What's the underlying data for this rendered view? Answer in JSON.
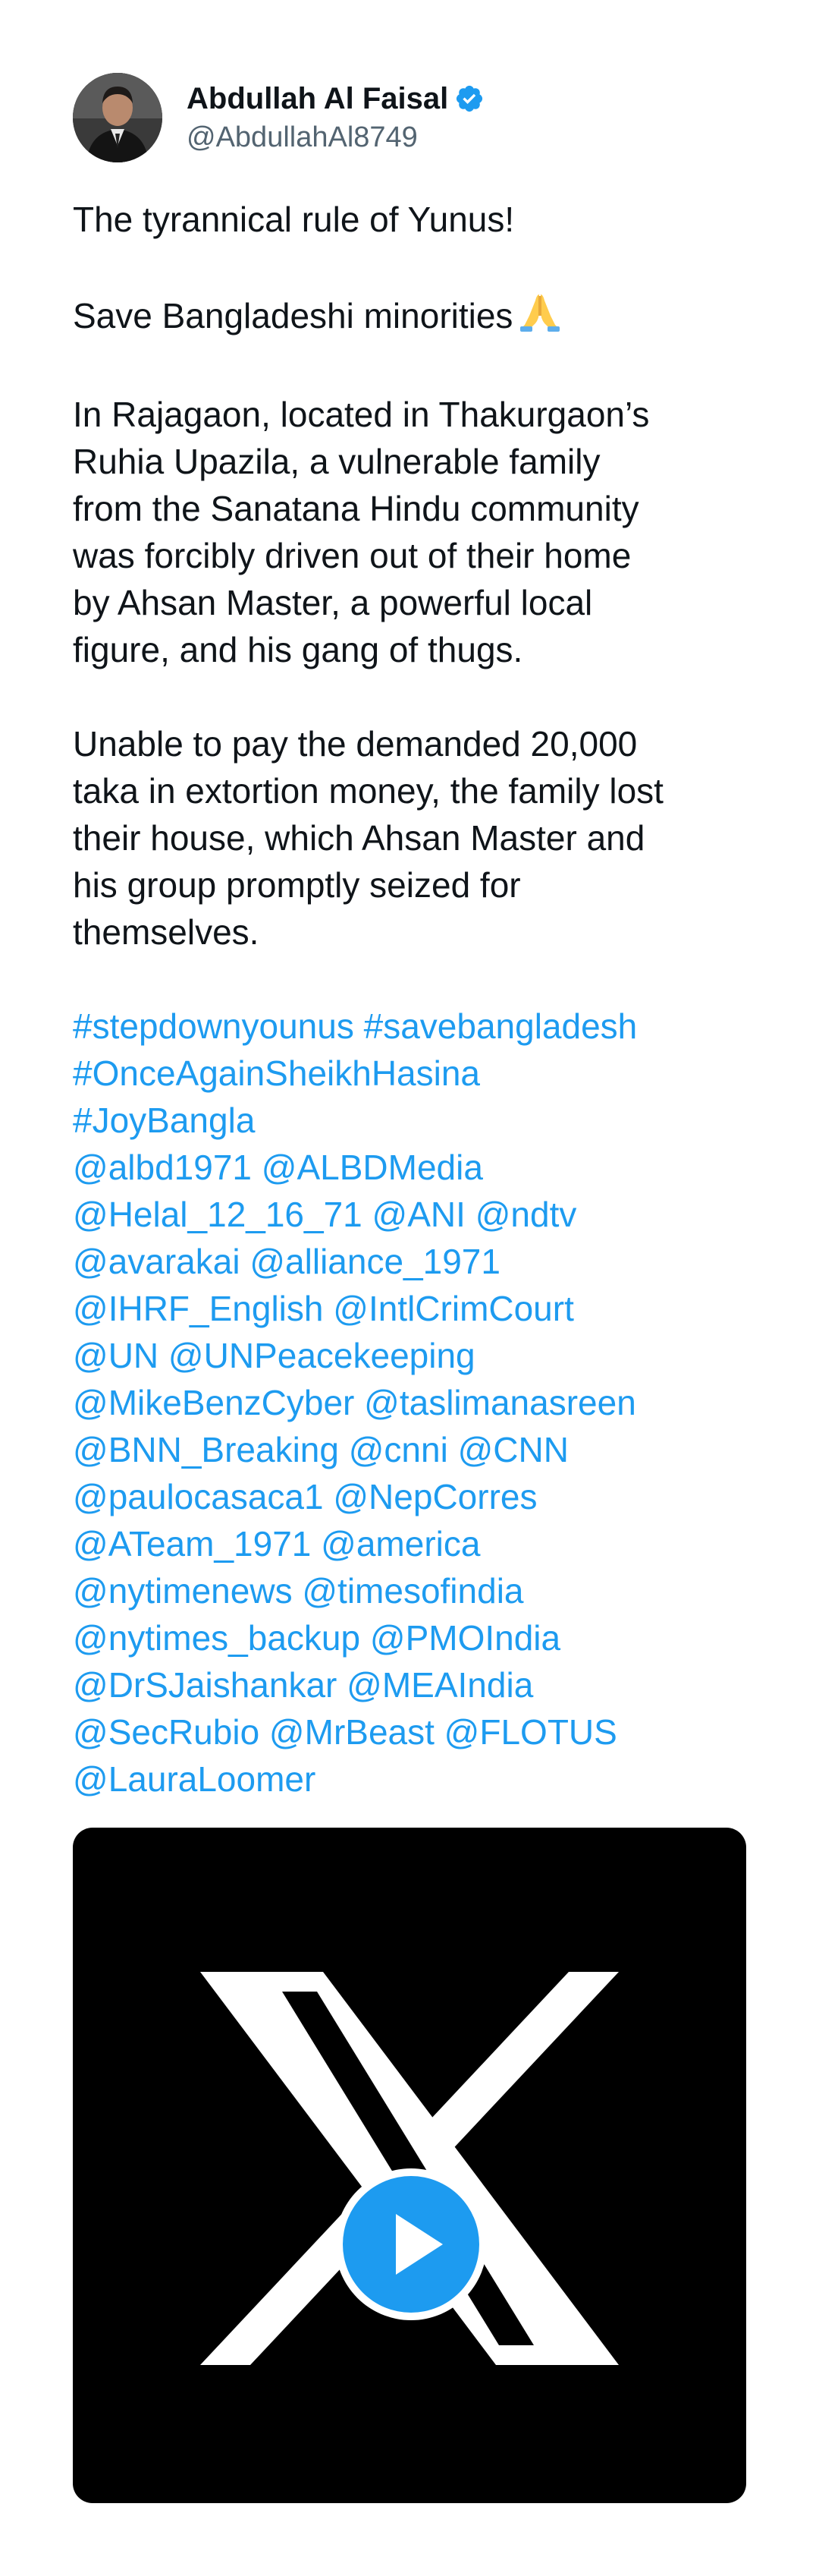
{
  "author": {
    "display_name": "Abdullah Al Faisal",
    "handle": "@AbdullahAl8749",
    "verified": true,
    "avatar_icon": "profile-photo-avatar"
  },
  "tweet": {
    "line1": "The tyrannical rule of Yunus!",
    "line2": "Save Bangladeshi minorities",
    "line2_emoji": "folded-hands",
    "para1": "In Rajagaon, located in Thakurgaon’s\nRuhia Upazila, a vulnerable family\nfrom the Sanatana Hindu community\nwas forcibly driven out of their home\nby Ahsan Master, a powerful local\nfigure, and his gang of thugs.",
    "para2": "Unable to pay the demanded 20,000\ntaka in extortion money, the family lost\ntheir house, which Ahsan Master and\nhis group promptly seized for\nthemselves.",
    "hashtags_mentions": "#stepdownyounus #savebangladesh\n#OnceAgainSheikhHasina\n#JoyBangla\n@albd1971 @ALBDMedia\n@Helal_12_16_71 @ANI @ndtv\n@avarakai @alliance_1971\n@IHRF_English @IntlCrimCourt\n@UN @UNPeacekeeping\n@MikeBenzCyber @taslimanasreen\n@BNN_Breaking @cnni @CNN\n@paulocasaca1 @NepCorres\n@ATeam_1971 @america\n@nytimenews @timesofindia\n@nytimes_backup @PMOIndia\n@DrSJaishankar @MEAIndia\n@SecRubio @MrBeast @FLOTUS\n@LauraLoomer"
  },
  "media": {
    "thumbnail_icon": "x-logo-icon",
    "play_icon": "play-icon"
  },
  "colors": {
    "link": "#1d9bf0",
    "text": "#0f1419",
    "secondary": "#536471",
    "media_bg": "#000000"
  }
}
